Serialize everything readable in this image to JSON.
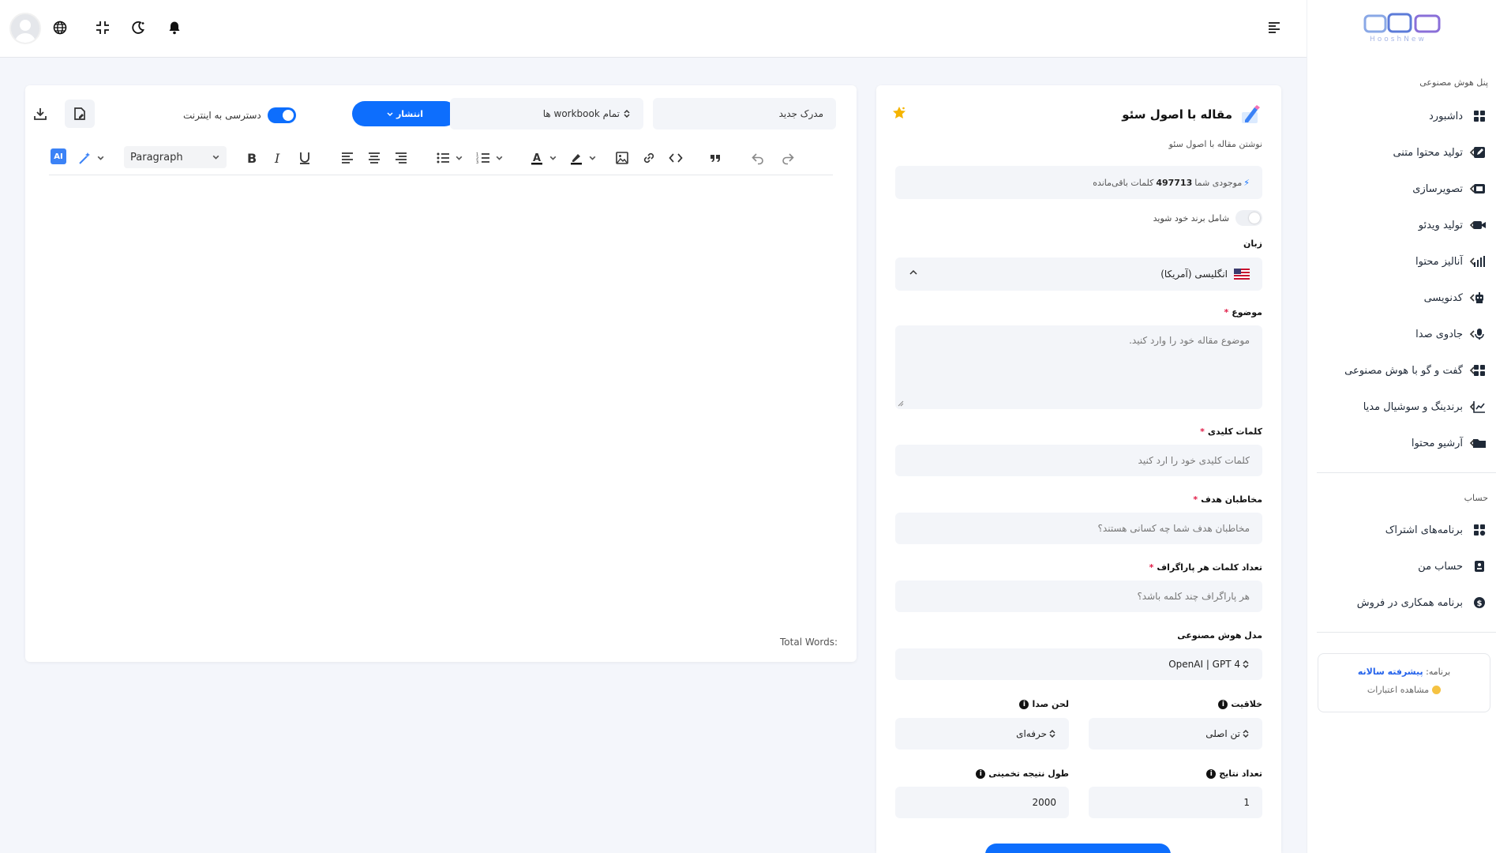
{
  "topbar": {
    "icons": [
      "bell-icon",
      "moon-icon",
      "collapse-icon",
      "globe-icon",
      "avatar"
    ]
  },
  "sidebar": {
    "logo_text": "HooshNew",
    "section_ai": "پنل هوش مصنوعی",
    "items": [
      {
        "label": "داشبورد",
        "icon": "dashboard-icon",
        "chevron": false
      },
      {
        "label": "تولید محتوا متنی",
        "icon": "edit-icon",
        "chevron": true
      },
      {
        "label": "تصویرسازی",
        "icon": "image-icon",
        "chevron": true
      },
      {
        "label": "تولید ویدئو",
        "icon": "video-icon",
        "chevron": true
      },
      {
        "label": "آنالیز محتوا",
        "icon": "chart-bars-icon",
        "chevron": true
      },
      {
        "label": "کدنویسی",
        "icon": "robot-icon",
        "chevron": true
      },
      {
        "label": "جادوی صدا",
        "icon": "mic-icon",
        "chevron": true
      },
      {
        "label": "گفت و گو با هوش مصنوعی",
        "icon": "chat-icon",
        "chevron": true
      },
      {
        "label": "برندینگ و سوشیال مدیا",
        "icon": "trend-icon",
        "chevron": true
      },
      {
        "label": "آرشیو محتوا",
        "icon": "folder-icon",
        "chevron": true
      }
    ],
    "section_account": "حساب",
    "account_items": [
      {
        "label": "برنامه‌های اشتراک",
        "icon": "subscription-icon"
      },
      {
        "label": "حساب من",
        "icon": "user-card-icon"
      },
      {
        "label": "برنامه همکاری در فروش",
        "icon": "dollar-icon"
      }
    ],
    "plan": {
      "prefix": "برنامه:",
      "value": "پیشرفته سالانه",
      "credits_link": "مشاهده اعتبارات"
    }
  },
  "editor": {
    "document_title": "مدرک جدید",
    "workbook_select": "تمام workbook ها",
    "publish_label": "انتشار",
    "internet_toggle_label": "دسترسی به اینترنت",
    "internet_toggle_on": true,
    "ai_badge": "AI",
    "paragraph_select": "Paragraph",
    "total_words_label": "Total Words:"
  },
  "form": {
    "title": "مقاله با اصول سئو",
    "subtitle": "نوشتن مقاله با اصول سئو",
    "balance_prefix": "موجودی شما",
    "balance_value": "497713",
    "balance_suffix": "کلمات باقی‌مانده",
    "brand_toggle_label": "شامل برند خود شوید",
    "language_label": "زبان",
    "language_value": "انگلیسی (آمریکا)",
    "topic_label": "موضوع",
    "topic_placeholder": "موضوع مقاله خود را وارد کنید.",
    "keywords_label": "کلمات کلیدی",
    "keywords_placeholder": "کلمات کلیدی خود را ارد کنید",
    "audience_label": "مخاطبان هدف",
    "audience_placeholder": "مخاطبان هدف شما چه کسانی هستند؟",
    "para_words_label": "تعداد کلمات هر پاراگراف",
    "para_words_placeholder": "هر پاراگراف چند کلمه باشد؟",
    "ai_model_label": "مدل هوش مصنوعی",
    "ai_model_value": "OpenAI | GPT 4",
    "creativity_label": "خلاقیت",
    "creativity_value": "تن اصلی",
    "tone_label": "لحن صدا",
    "tone_value": "حرفه‌ای",
    "results_count_label": "تعداد نتایج",
    "results_count_value": "1",
    "est_length_label": "طول نتیجه تخمینی",
    "est_length_value": "2000",
    "colors": {
      "accent": "#0d6efd",
      "required": "#e11d48"
    }
  }
}
